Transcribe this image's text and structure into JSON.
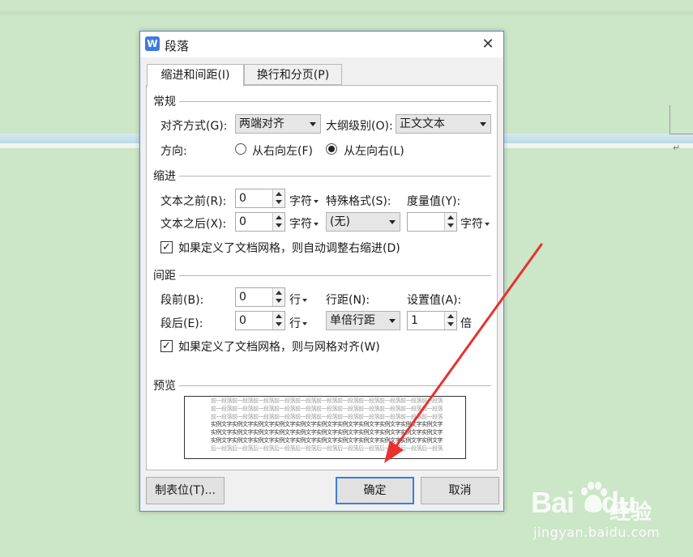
{
  "dialog": {
    "title": "段落",
    "app_icon_letter": "W",
    "close_glyph": "✕"
  },
  "tabs": [
    {
      "label": "缩进和间距(I)",
      "active": true
    },
    {
      "label": "换行和分页(P)",
      "active": false
    }
  ],
  "general": {
    "heading": "常规",
    "alignment_label": "对齐方式(G):",
    "alignment_value": "两端对齐",
    "outline_label": "大纲级别(O):",
    "outline_value": "正文文本",
    "direction_label": "方向:",
    "rtl_label": "从右向左(F)",
    "ltr_label": "从左向右(L)",
    "direction_selected": "ltr"
  },
  "indent": {
    "heading": "缩进",
    "before_label": "文本之前(R):",
    "before_value": "0",
    "before_unit": "字符",
    "after_label": "文本之后(X):",
    "after_value": "0",
    "after_unit": "字符",
    "special_label": "特殊格式(S):",
    "special_value": "(无)",
    "measure_label": "度量值(Y):",
    "measure_value": "",
    "measure_unit": "字符",
    "grid_checkbox_label": "如果定义了文档网格，则自动调整右缩进(D)",
    "grid_checked": true
  },
  "spacing": {
    "heading": "间距",
    "before_label": "段前(B):",
    "before_value": "0",
    "before_unit": "行",
    "after_label": "段后(E):",
    "after_value": "0",
    "after_unit": "行",
    "line_label": "行距(N):",
    "line_value": "单倍行距",
    "setting_label": "设置值(A):",
    "setting_value": "1",
    "setting_unit": "倍",
    "grid_checkbox_label": "如果定义了文档网格，则与网格对齐(W)",
    "grid_checked": true
  },
  "preview": {
    "heading": "预览",
    "lines": [
      {
        "text": "前一段落前一段落前一段落前一段落前一段落前一段落前一段落前一段落前一段落前一段落前一段落",
        "color": "#9a9a9a"
      },
      {
        "text": "前一段落前一段落前一段落前一段落前一段落前一段落前一段落前一段落前一段落前一段落前一段落",
        "color": "#9a9a9a"
      },
      {
        "text": "前一段落前一段落前一段落前一段落前一段落前一段落前一段落前一段落前一段落前一段落前一段落",
        "color": "#9a9a9a"
      },
      {
        "text": "实例文字实例文字实例文字实例文字实例文字实例文字实例文字实例文字实例文字实例文字实例文字",
        "color": "#333333"
      },
      {
        "text": "实例文字实例文字实例文字实例文字实例文字实例文字实例文字实例文字实例文字实例文字实例文字",
        "color": "#333333"
      },
      {
        "text": "实例文字实例文字实例文字实例文字实例文字实例文字实例文字实例文字实例文字实例文字实例文字",
        "color": "#333333"
      },
      {
        "text": "后一段落后一段落后一段落后一段落后一段落后一段落后一段落后一段落后一段落后一段落后一段落",
        "color": "#9a9a9a"
      }
    ]
  },
  "buttons": {
    "tabs_label": "制表位(T)...",
    "ok_label": "确定",
    "cancel_label": "取消"
  },
  "watermark": {
    "logo": "Bai",
    "logo_suffix": "du",
    "cn": "经验",
    "url": "jingyan.baidu.com"
  },
  "colors": {
    "background": "#cce6c8",
    "dialog_border": "#4a8fd8",
    "primary_button_border": "#3c7fd6",
    "annotation_arrow": "#e8322f"
  }
}
